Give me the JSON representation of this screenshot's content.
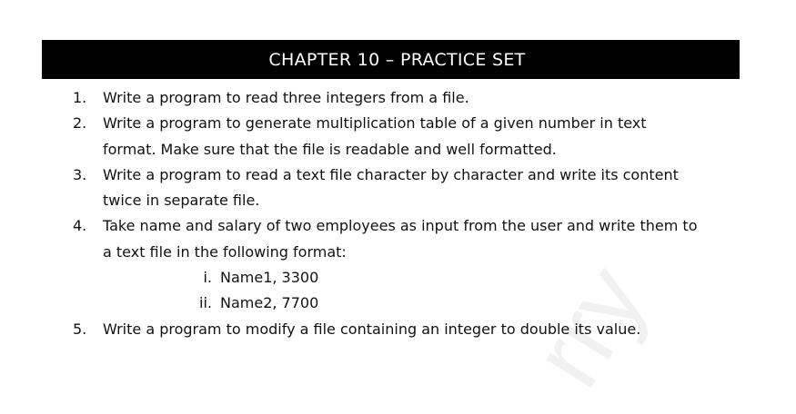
{
  "header": {
    "title": "CHAPTER 10 – PRACTICE SET"
  },
  "watermark": {
    "text": "rry"
  },
  "items": [
    {
      "num": "1.",
      "lines": [
        "Write a program to read three integers from a file."
      ]
    },
    {
      "num": "2.",
      "lines": [
        "Write a program to generate multiplication table of a given number in text",
        "format. Make sure that the file is readable and well formatted."
      ]
    },
    {
      "num": "3.",
      "lines": [
        "Write a program to read a text file character by character and write its content",
        "twice in separate file."
      ]
    },
    {
      "num": "4.",
      "lines": [
        "Take name and salary of two employees as input from the user and write them to",
        "a text file in the following format:"
      ],
      "sub": [
        {
          "num": "i.",
          "text": "Name1, 3300"
        },
        {
          "num": "ii.",
          "text": "Name2, 7700"
        }
      ]
    },
    {
      "num": "5.",
      "lines": [
        "Write a program to modify a file containing an integer to double its value."
      ]
    }
  ]
}
